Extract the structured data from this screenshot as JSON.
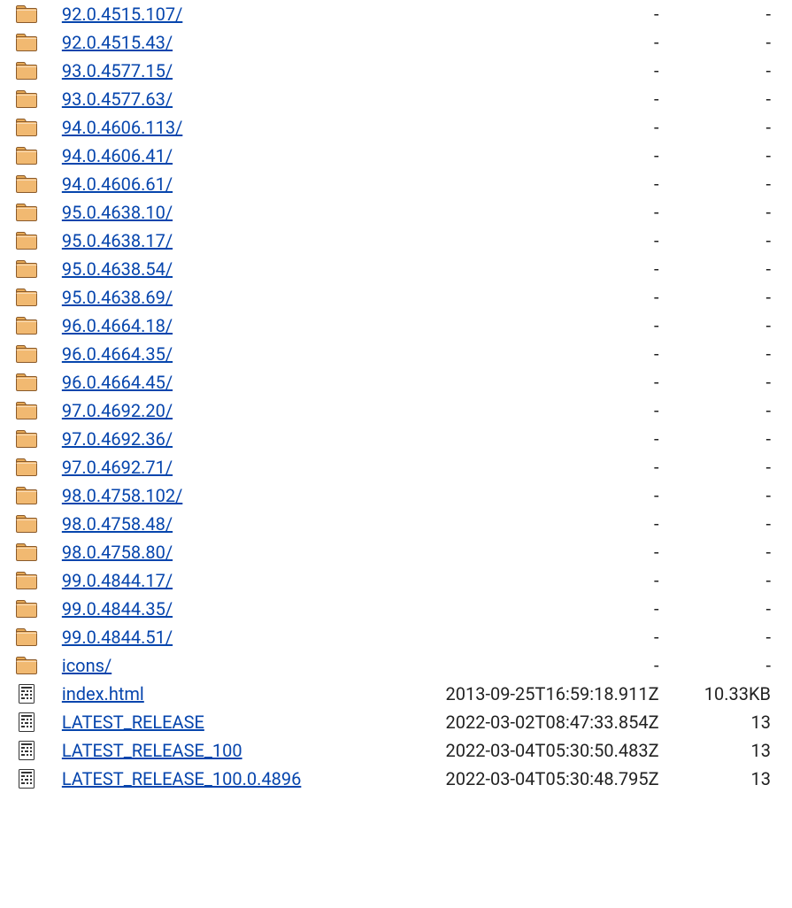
{
  "listing": {
    "dash": "-",
    "entries": [
      {
        "type": "dir",
        "name": "92.0.4515.107/",
        "date": "-",
        "size": "-"
      },
      {
        "type": "dir",
        "name": "92.0.4515.43/",
        "date": "-",
        "size": "-"
      },
      {
        "type": "dir",
        "name": "93.0.4577.15/",
        "date": "-",
        "size": "-"
      },
      {
        "type": "dir",
        "name": "93.0.4577.63/",
        "date": "-",
        "size": "-"
      },
      {
        "type": "dir",
        "name": "94.0.4606.113/",
        "date": "-",
        "size": "-"
      },
      {
        "type": "dir",
        "name": "94.0.4606.41/",
        "date": "-",
        "size": "-"
      },
      {
        "type": "dir",
        "name": "94.0.4606.61/",
        "date": "-",
        "size": "-"
      },
      {
        "type": "dir",
        "name": "95.0.4638.10/",
        "date": "-",
        "size": "-"
      },
      {
        "type": "dir",
        "name": "95.0.4638.17/",
        "date": "-",
        "size": "-"
      },
      {
        "type": "dir",
        "name": "95.0.4638.54/",
        "date": "-",
        "size": "-"
      },
      {
        "type": "dir",
        "name": "95.0.4638.69/",
        "date": "-",
        "size": "-"
      },
      {
        "type": "dir",
        "name": "96.0.4664.18/",
        "date": "-",
        "size": "-"
      },
      {
        "type": "dir",
        "name": "96.0.4664.35/",
        "date": "-",
        "size": "-"
      },
      {
        "type": "dir",
        "name": "96.0.4664.45/",
        "date": "-",
        "size": "-"
      },
      {
        "type": "dir",
        "name": "97.0.4692.20/",
        "date": "-",
        "size": "-"
      },
      {
        "type": "dir",
        "name": "97.0.4692.36/",
        "date": "-",
        "size": "-"
      },
      {
        "type": "dir",
        "name": "97.0.4692.71/",
        "date": "-",
        "size": "-"
      },
      {
        "type": "dir",
        "name": "98.0.4758.102/",
        "date": "-",
        "size": "-"
      },
      {
        "type": "dir",
        "name": "98.0.4758.48/",
        "date": "-",
        "size": "-"
      },
      {
        "type": "dir",
        "name": "98.0.4758.80/",
        "date": "-",
        "size": "-"
      },
      {
        "type": "dir",
        "name": "99.0.4844.17/",
        "date": "-",
        "size": "-"
      },
      {
        "type": "dir",
        "name": "99.0.4844.35/",
        "date": "-",
        "size": "-"
      },
      {
        "type": "dir",
        "name": "99.0.4844.51/",
        "date": "-",
        "size": "-"
      },
      {
        "type": "dir",
        "name": "icons/",
        "date": "-",
        "size": "-"
      },
      {
        "type": "file",
        "name": "index.html",
        "date": "2013-09-25T16:59:18.911Z",
        "size": "10.33KB"
      },
      {
        "type": "file",
        "name": "LATEST_RELEASE",
        "date": "2022-03-02T08:47:33.854Z",
        "size": "13"
      },
      {
        "type": "file",
        "name": "LATEST_RELEASE_100",
        "date": "2022-03-04T05:30:50.483Z",
        "size": "13"
      },
      {
        "type": "file",
        "name": "LATEST_RELEASE_100.0.4896",
        "date": "2022-03-04T05:30:48.795Z",
        "size": "13"
      }
    ]
  }
}
